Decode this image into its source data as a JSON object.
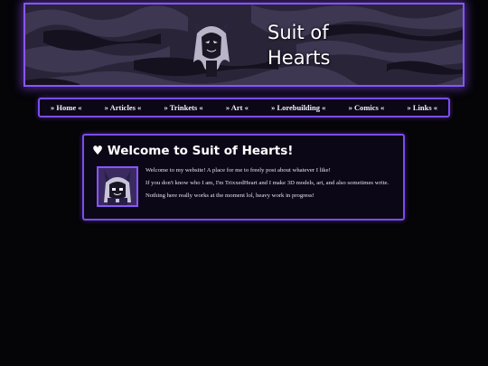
{
  "banner": {
    "title": "Suit of Hearts",
    "mascot_icon": "cat-eared-character-icon"
  },
  "nav": {
    "items": [
      {
        "label": "» Home «"
      },
      {
        "label": "» Articles «"
      },
      {
        "label": "» Trinkets «"
      },
      {
        "label": "» Art «"
      },
      {
        "label": "» Lorebuilding «"
      },
      {
        "label": "» Comics «"
      },
      {
        "label": "» Links «"
      }
    ]
  },
  "welcome": {
    "title": "♥ Welcome to Suit of Hearts!",
    "avatar_icon": "pixel-avatar-icon",
    "paragraphs": [
      "Welcome to my website! A place for me to freely post about whatever I like!",
      "If you don't know who I am, I'm TrixxedHeart and I make 3D models, art, and also sometimes write.",
      "Nothing here really works at the moment lol, heavy work in progress!"
    ]
  },
  "colors": {
    "accent": "#8a55ff",
    "background": "#050407",
    "panel": "#0b0716"
  }
}
